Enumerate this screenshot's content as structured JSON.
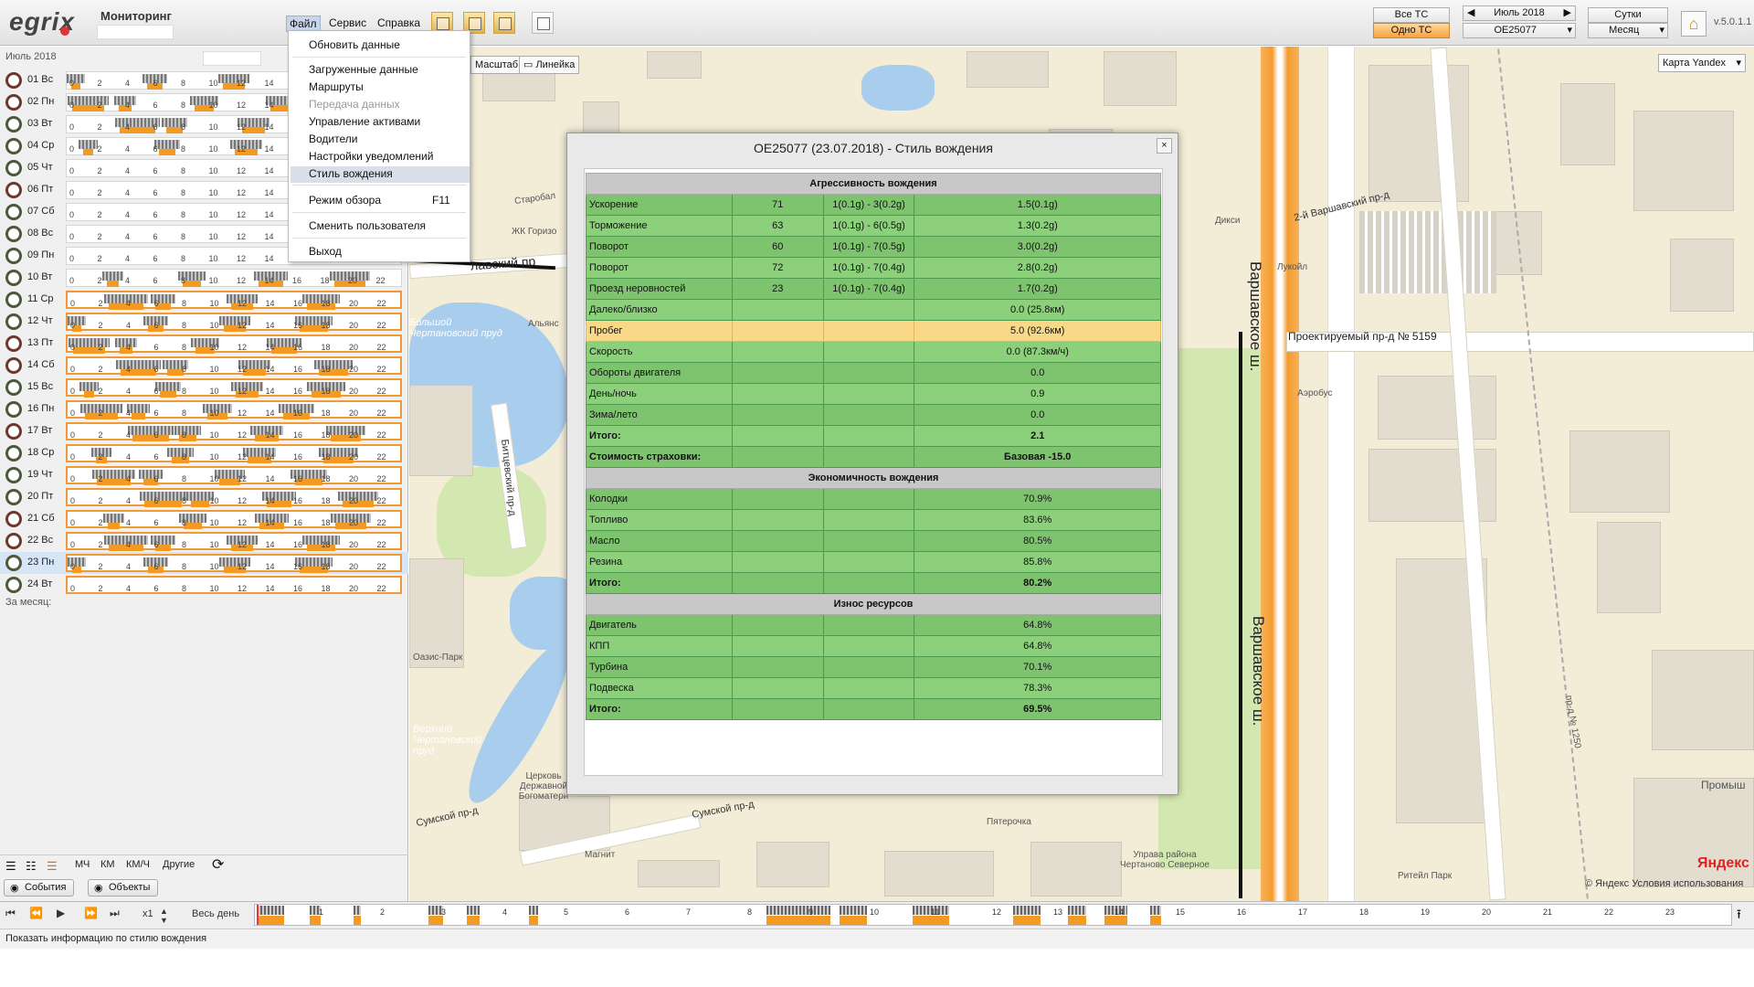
{
  "app": {
    "logo": "egrix",
    "title": "Мониторинг",
    "version": "v.5.0.1.1"
  },
  "menu": [
    "Файл",
    "Сервис",
    "Справка"
  ],
  "file_menu": [
    {
      "label": "Обновить данные",
      "hotkey": "",
      "disabled": false
    },
    {
      "label": "Загруженные данные",
      "hotkey": "",
      "disabled": false
    },
    {
      "label": "Маршруты",
      "hotkey": "",
      "disabled": false
    },
    {
      "label": "Передача данных",
      "hotkey": "",
      "disabled": true
    },
    {
      "label": "Управление активами",
      "hotkey": "",
      "disabled": false
    },
    {
      "label": "Водители",
      "hotkey": "",
      "disabled": false
    },
    {
      "label": "Настройки уведомлений",
      "hotkey": "",
      "disabled": false
    },
    {
      "label": "Стиль вождения",
      "hotkey": "",
      "disabled": false,
      "highlighted": true
    },
    {
      "label": "Режим обзора",
      "hotkey": "F11",
      "disabled": false
    },
    {
      "label": "Сменить пользователя",
      "hotkey": "",
      "disabled": false
    },
    {
      "label": "Выход",
      "hotkey": "",
      "disabled": false
    }
  ],
  "right_controls": {
    "all_vehicles": "Все ТС",
    "one_vehicle": "Одно ТС",
    "month": "Июль 2018",
    "vehicle": "ОЕ25077",
    "day": "Сутки",
    "month_mode": "Месяц",
    "map_type": "Карта Yandex"
  },
  "map_buttons": {
    "scale": "Масштаб",
    "ruler": "Линейка"
  },
  "left_panel": {
    "month_label": "Июль 2018",
    "per_month": "За месяц:",
    "ticks": [
      "0",
      "2",
      "4",
      "6",
      "8",
      "10",
      "12",
      "14",
      "16",
      "18",
      "20",
      "22"
    ],
    "days": [
      "01 Вс",
      "02 Пн",
      "03 Вт",
      "04 Ср",
      "05 Чт",
      "06 Пт",
      "07 Сб",
      "08 Вс",
      "09 Пн",
      "10 Вт",
      "11 Ср",
      "12 Чт",
      "13 Пт",
      "14 Сб",
      "15 Вс",
      "16 Пн",
      "17 Вт",
      "18 Ср",
      "19 Чт",
      "20 Пт",
      "21 Сб",
      "22 Вс",
      "23 Пн",
      "24 Вт"
    ],
    "toolbar": {
      "mch": "МЧ",
      "km": "КМ",
      "kmh": "КМ/Ч",
      "other": "Другие"
    },
    "events_btn": "События",
    "objects_btn": "Объекты"
  },
  "dialog": {
    "title": "ОЕ25077 (23.07.2018) - Стиль вождения",
    "close": "×",
    "sections": [
      {
        "title": "Агрессивность вождения",
        "rows": [
          {
            "cells": [
              "Ускорение",
              "71",
              "1(0.1g) - 3(0.2g)",
              "1.5(0.1g)"
            ]
          },
          {
            "cells": [
              "Торможение",
              "63",
              "1(0.1g) - 6(0.5g)",
              "1.3(0.2g)"
            ]
          },
          {
            "cells": [
              "Поворот",
              "60",
              "1(0.1g) - 7(0.5g)",
              "3.0(0.2g)"
            ]
          },
          {
            "cells": [
              "Поворот",
              "72",
              "1(0.1g) - 7(0.4g)",
              "2.8(0.2g)"
            ]
          },
          {
            "cells": [
              "Проезд неровностей",
              "23",
              "1(0.1g) - 7(0.4g)",
              "1.7(0.2g)"
            ]
          },
          {
            "cells": [
              "Далеко/близко",
              "",
              "",
              "0.0 (25.8км)"
            ]
          },
          {
            "cells": [
              "Пробег",
              "",
              "",
              "5.0 (92.6км)"
            ],
            "highlight": true
          },
          {
            "cells": [
              "Скорость",
              "",
              "",
              "0.0 (87.3км/ч)"
            ]
          },
          {
            "cells": [
              "Обороты двигателя",
              "",
              "",
              "0.0"
            ]
          },
          {
            "cells": [
              "День/ночь",
              "",
              "",
              "0.9"
            ]
          },
          {
            "cells": [
              "Зима/лето",
              "",
              "",
              "0.0"
            ]
          },
          {
            "cells": [
              "Итого:",
              "",
              "",
              "2.1"
            ],
            "total": true
          },
          {
            "cells": [
              "Стоимость страховки:",
              "",
              "",
              "Базовая -15.0"
            ],
            "total": true
          }
        ]
      },
      {
        "title": "Экономичность вождения",
        "rows": [
          {
            "cells": [
              "Колодки",
              "",
              "",
              "70.9%"
            ]
          },
          {
            "cells": [
              "Топливо",
              "",
              "",
              "83.6%"
            ]
          },
          {
            "cells": [
              "Масло",
              "",
              "",
              "80.5%"
            ]
          },
          {
            "cells": [
              "Резина",
              "",
              "",
              "85.8%"
            ]
          },
          {
            "cells": [
              "Итого:",
              "",
              "",
              "80.2%"
            ],
            "total": true
          }
        ]
      },
      {
        "title": "Износ ресурсов",
        "rows": [
          {
            "cells": [
              "Двигатель",
              "",
              "",
              "64.8%"
            ]
          },
          {
            "cells": [
              "КПП",
              "",
              "",
              "64.8%"
            ]
          },
          {
            "cells": [
              "Турбина",
              "",
              "",
              "70.1%"
            ]
          },
          {
            "cells": [
              "Подвеска",
              "",
              "",
              "78.3%"
            ]
          },
          {
            "cells": [
              "Итого:",
              "",
              "",
              "69.5%"
            ],
            "total": true
          }
        ]
      }
    ]
  },
  "map_labels": [
    "Варшавское ш.",
    "Проектируемый пр-д № 5159",
    "2-й Варшавский пр-д",
    "Большой Чертановский пруд",
    "Сумской пр-д",
    "Битцевский пр-д",
    "Аэробус",
    "Лукойл",
    "Дикси",
    "Альянс",
    "Пятерочка",
    "Магнит",
    "Ритейл Парк",
    "Церковь Державной Богоматери",
    "Оазис-Парк",
    "Верхний Чертановский пруд",
    "Управа района Чертаново Северное",
    "Старобал",
    "ЖК Горизо",
    "лавский пр",
    "пр-д № 1250",
    "Промыш"
  ],
  "bottom": {
    "speed": "x1",
    "all_day": "Весь день",
    "hours": [
      "1",
      "2",
      "3",
      "4",
      "5",
      "6",
      "7",
      "8",
      "9",
      "10",
      "11",
      "12",
      "13",
      "14",
      "15",
      "16",
      "17",
      "18",
      "19",
      "20",
      "21",
      "22",
      "23"
    ]
  },
  "status": "Показать информацию по стилю вождения",
  "copyright": "© Яндекс Условия использования",
  "yandex": "Яндекс"
}
